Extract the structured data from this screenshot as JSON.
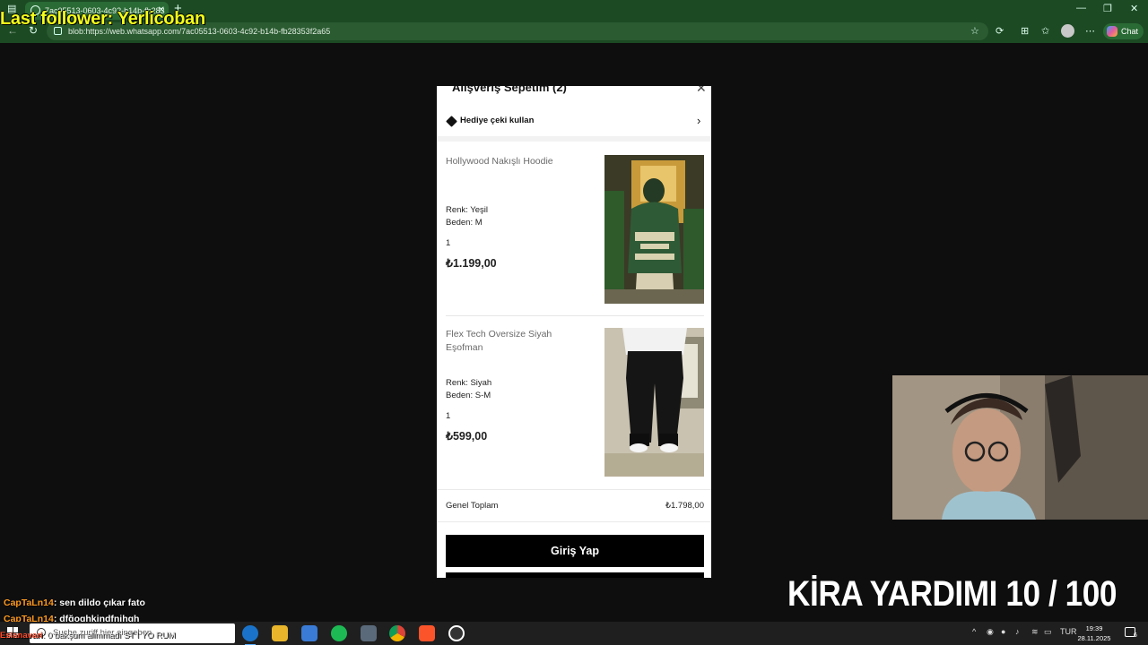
{
  "browser": {
    "tab_title": "7ac05513-0603-4c92-b14b-fb283",
    "url": "blob:https://web.whatsapp.com/7ac05513-0603-4c92-b14b-fb28353f2a65",
    "chat_label": "Chat",
    "icons": [
      "back-icon",
      "refresh-icon",
      "star-icon",
      "extensions-icon",
      "favorites-icon",
      "profile-icon",
      "more-icon"
    ]
  },
  "overlay": {
    "last_follower": "Last follower: Yerlicoban",
    "kira": "KİRA YARDIMI  10 / 100"
  },
  "cart": {
    "title": "Alışveriş Sepetim (2)",
    "gift_label": "Hediye çeki kullan",
    "items": [
      {
        "name": "Hollywood Nakışlı Hoodie",
        "color": "Renk: Yeşil",
        "size": "Beden: M",
        "qty": "1",
        "price": "₺1.199,00"
      },
      {
        "name": "Flex Tech Oversize Siyah Eşofman",
        "color": "Renk: Siyah",
        "size": "Beden: S-M",
        "qty": "1",
        "price": "₺599,00"
      }
    ],
    "total_label": "Genel Toplam",
    "total_value": "₺1.798,00",
    "login_label": "Giriş Yap"
  },
  "chat": [
    {
      "user": "CapTaLn14",
      "text": ": sen dildo çıkar fato"
    },
    {
      "user": "CapTaLn14",
      "text": ": dfğoghkjndfnjhgh"
    }
  ],
  "ticker": {
    "user": "Eslanavari",
    "text": ": 0 bakşum alimmadı ST I YO RUM"
  },
  "taskbar": {
    "search_placeholder": "Suche zuriff hier eingeben",
    "lang": "TUR",
    "time": "19:39",
    "date": "28.11.2025",
    "notif_count": "6"
  }
}
